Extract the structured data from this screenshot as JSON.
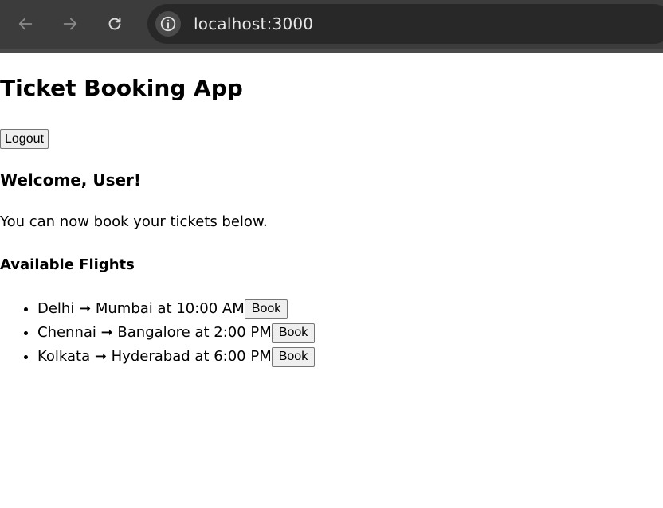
{
  "browser": {
    "url": "localhost:3000",
    "icons": {
      "back": "arrow-left-icon",
      "forward": "arrow-right-icon",
      "reload": "reload-icon",
      "info": "info-icon"
    }
  },
  "app": {
    "title": "Ticket Booking App",
    "logout_label": "Logout",
    "welcome": "Welcome, User!",
    "intro": "You can now book your tickets below.",
    "flights_heading": "Available Flights",
    "flights": [
      {
        "text": "Delhi ➞ Mumbai at 10:00 AM",
        "book_label": "Book"
      },
      {
        "text": "Chennai ➞ Bangalore at 2:00 PM",
        "book_label": "Book"
      },
      {
        "text": "Kolkata ➞ Hyderabad at 6:00 PM",
        "book_label": "Book"
      }
    ]
  }
}
